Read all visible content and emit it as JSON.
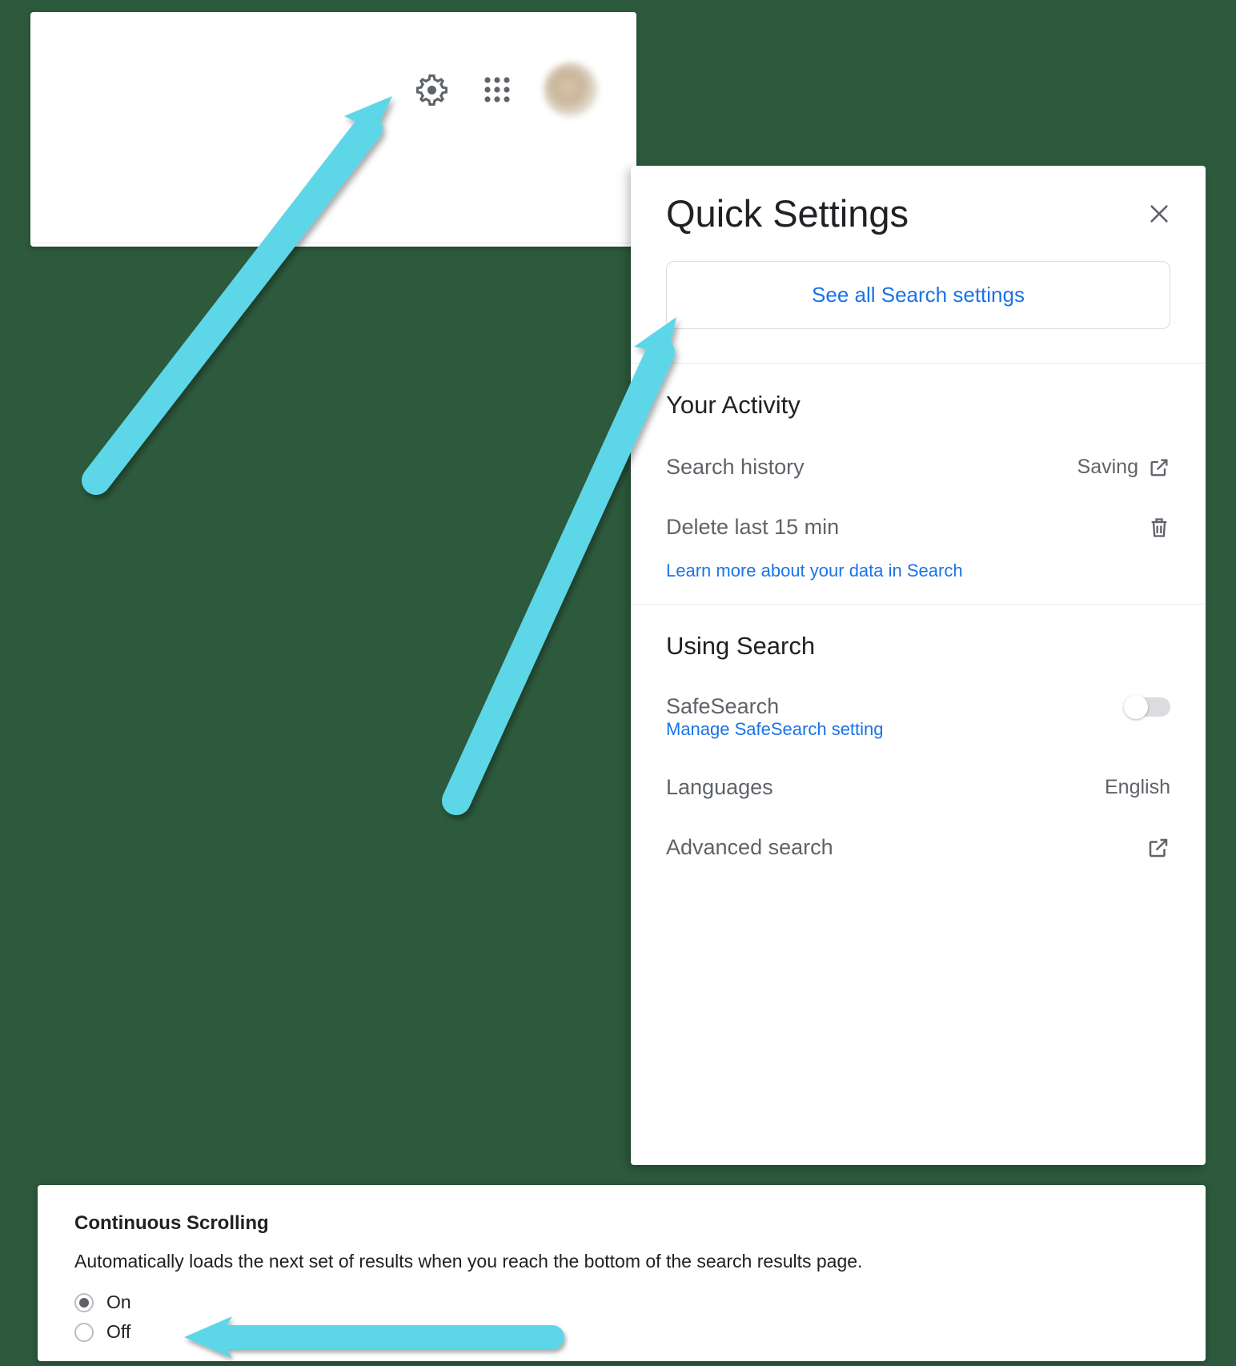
{
  "quickSettings": {
    "title": "Quick Settings",
    "seeAll": "See all Search settings",
    "activity": {
      "heading": "Your Activity",
      "searchHistory": {
        "label": "Search history",
        "status": "Saving"
      },
      "deleteLast": {
        "label": "Delete last 15 min"
      },
      "learnMore": "Learn more about your data in Search"
    },
    "usingSearch": {
      "heading": "Using Search",
      "safeSearch": {
        "label": "SafeSearch",
        "manage": "Manage SafeSearch setting"
      },
      "languages": {
        "label": "Languages",
        "value": "English"
      },
      "advanced": {
        "label": "Advanced search"
      }
    }
  },
  "continuousScrolling": {
    "title": "Continuous Scrolling",
    "description": "Automatically loads the next set of results when you reach the bottom of the search results page.",
    "options": {
      "on": "On",
      "off": "Off"
    }
  }
}
